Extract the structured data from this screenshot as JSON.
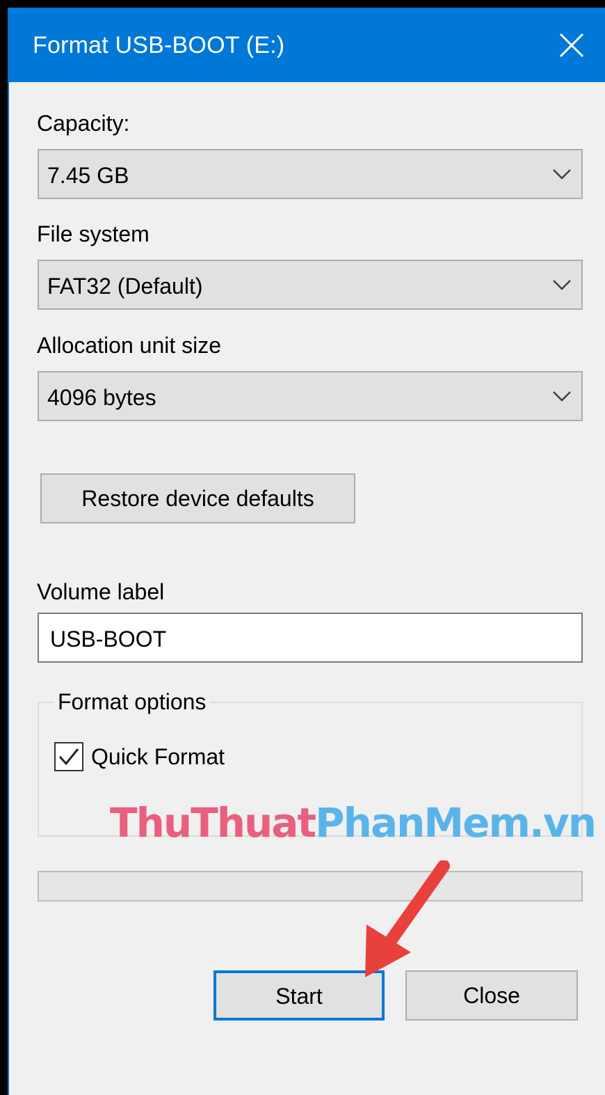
{
  "window": {
    "title": "Format USB-BOOT (E:)"
  },
  "capacity": {
    "label": "Capacity:",
    "value": "7.45 GB"
  },
  "file_system": {
    "label": "File system",
    "value": "FAT32 (Default)"
  },
  "allocation": {
    "label": "Allocation unit size",
    "value": "4096 bytes"
  },
  "restore_button": "Restore device defaults",
  "volume": {
    "label": "Volume label",
    "value": "USB-BOOT"
  },
  "format_options": {
    "legend": "Format options",
    "quick_format_label": "Quick Format",
    "quick_format_checked": true
  },
  "watermark": {
    "part1": "ThuThuat",
    "part2": "PhanMem.vn"
  },
  "buttons": {
    "start": "Start",
    "close": "Close"
  },
  "colors": {
    "titlebar": "#0078d7",
    "arrow": "#e8413c",
    "focus_border": "#0078d7"
  }
}
